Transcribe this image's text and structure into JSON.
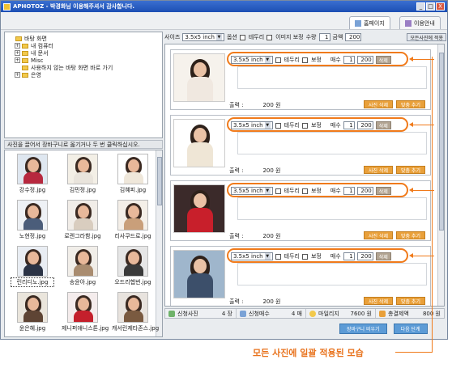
{
  "window": {
    "title": "APHOTOZ - 박경화님 이용해주셔서 감사합니다.",
    "controls": [
      "_",
      "□",
      "X"
    ]
  },
  "top_tabs": {
    "home": "홈페이지",
    "guide": "이용안내"
  },
  "tree": {
    "items": [
      {
        "label": "바탕 화면",
        "level": 0,
        "expand": ""
      },
      {
        "label": "내 컴퓨터",
        "level": 1,
        "expand": "+"
      },
      {
        "label": "내 문서",
        "level": 1,
        "expand": "+"
      },
      {
        "label": "Misc",
        "level": 1,
        "expand": "+"
      },
      {
        "label": "사용하지 않는 바탕 화면 바로 가기",
        "level": 1,
        "expand": ""
      },
      {
        "label": "은영",
        "level": 1,
        "expand": "+"
      }
    ]
  },
  "hint_text": "사진을 끌어서 장바구니로 옮기거나 두 번 클릭하십시오.",
  "thumbnails": [
    {
      "name": "강수정.jpg",
      "color": "#dfe7f0",
      "body": "#b7283e"
    },
    {
      "name": "김민정.jpg",
      "color": "#f3efe6",
      "body": "#e9e4dc"
    },
    {
      "name": "김혜피.jpg",
      "color": "#ffffff",
      "body": "#efe7da"
    },
    {
      "name": "노현정.jpg",
      "color": "#eef1f5",
      "body": "#4b5d7a"
    },
    {
      "name": "로렌그라함.jpg",
      "color": "#f1ede8",
      "body": "#d9cdbf"
    },
    {
      "name": "리사쿠드로.jpg",
      "color": "#f4efe8",
      "body": "#c99f7a"
    },
    {
      "name": "린리디노.jpg",
      "color": "#e9edf3",
      "body": "#2b3345"
    },
    {
      "name": "송윤아.jpg",
      "color": "#f1eee9",
      "body": "#a98c70"
    },
    {
      "name": "오드리헵번.jpg",
      "color": "#e6e6e6",
      "body": "#3a3a3a"
    },
    {
      "name": "윤은혜.jpg",
      "color": "#eae5dc",
      "body": "#5e4434"
    },
    {
      "name": "제니퍼애니스톤.jpg",
      "color": "#f4ecec",
      "body": "#c4202c"
    },
    {
      "name": "캐서린제타존스.jpg",
      "color": "#e8e3de",
      "body": "#7a5a40"
    }
  ],
  "toolbar": {
    "size_label": "사이즈",
    "size_value": "3.5x5 inch",
    "option_label": "옵션",
    "border_label": "테두리",
    "correction_label": "이미지 보정",
    "qty_label": "수량",
    "qty_value": "1",
    "amount_label": "금액",
    "amount_value": "200",
    "apply_all_label": "모든사진에 적용"
  },
  "photo_cards": [
    {
      "size": "3.5x5 inch",
      "border": "테두리",
      "correction": "보정",
      "qty_label": "매수",
      "qty": "1",
      "price": "200",
      "delete": "삭제",
      "price_label": "출력 :",
      "price_value": "200 원",
      "btn1": "사진 삭제",
      "btn2": "맞춤 추기",
      "bg": "#f6f2ec",
      "body": "#f0e8e0"
    },
    {
      "size": "3.5x5 inch",
      "border": "테두리",
      "correction": "보정",
      "qty_label": "매수",
      "qty": "1",
      "price": "200",
      "delete": "삭제",
      "price_label": "출력 :",
      "price_value": "200 원",
      "btn1": "사진 삭제",
      "btn2": "맞춤 추기",
      "bg": "#ffffff",
      "body": "#efe6d6"
    },
    {
      "size": "3.5x5 inch",
      "border": "테두리",
      "correction": "보정",
      "qty_label": "매수",
      "qty": "1",
      "price": "200",
      "delete": "삭제",
      "price_label": "출력 :",
      "price_value": "200 원",
      "btn1": "사진 삭제",
      "btn2": "맞춤 추기",
      "bg": "#3b2a2a",
      "body": "#c81f2b"
    },
    {
      "size": "3.5x5 inch",
      "border": "테두리",
      "correction": "보정",
      "qty_label": "매수",
      "qty": "1",
      "price": "200",
      "delete": "삭제",
      "price_label": "출력 :",
      "price_value": "200 원",
      "btn1": "사진 삭제",
      "btn2": "맞춤 추기",
      "bg": "#9fb6cc",
      "body": "#3c4f6a"
    }
  ],
  "status": {
    "photos_label": "신청사진",
    "photos_value": "4 장",
    "sheets_label": "신청매수",
    "sheets_value": "4 매",
    "mileage_label": "마일리지",
    "mileage_value": "7600 원",
    "total_label": "총결제액",
    "total_value": "800 원"
  },
  "bottom_buttons": {
    "empty_cart": "장바구니 비우기",
    "next_step": "다음 단계"
  },
  "caption": "모든 사진에 일괄 적용된 모습"
}
